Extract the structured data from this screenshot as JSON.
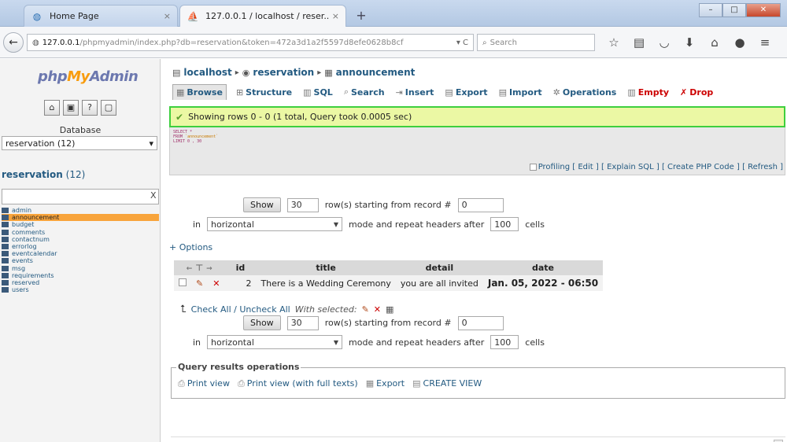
{
  "browser": {
    "tabs": [
      {
        "label": "Home Page",
        "active": false,
        "icon": "globe-icon"
      },
      {
        "label": "127.0.0.1 / localhost / reser...",
        "active": true,
        "icon": "pma-favicon"
      }
    ],
    "url_host": "127.0.0.1",
    "url_path": "/phpmyadmin/index.php?db=reservation&token=472a3d1a2f5597d8efe0628b8cf",
    "search_placeholder": "Search",
    "new_tab": "+"
  },
  "sidebar": {
    "logo": {
      "php": "php",
      "my": "My",
      "admin": "Admin"
    },
    "database_label": "Database",
    "database_selected": "reservation (12)",
    "db_name": "reservation",
    "db_count": "(12)",
    "filter_clear": "X",
    "tables": [
      {
        "label": "admin",
        "selected": false
      },
      {
        "label": "announcement",
        "selected": true
      },
      {
        "label": "budget",
        "selected": false
      },
      {
        "label": "comments",
        "selected": false
      },
      {
        "label": "contactnum",
        "selected": false
      },
      {
        "label": "errorlog",
        "selected": false
      },
      {
        "label": "eventcalendar",
        "selected": false
      },
      {
        "label": "events",
        "selected": false
      },
      {
        "label": "msg",
        "selected": false
      },
      {
        "label": "requirements",
        "selected": false
      },
      {
        "label": "reserved",
        "selected": false
      },
      {
        "label": "users",
        "selected": false
      }
    ]
  },
  "breadcrumb": {
    "server": "localhost",
    "database": "reservation",
    "table": "announcement"
  },
  "tabs": [
    {
      "label": "Browse",
      "icon": "browse-icon",
      "active": true
    },
    {
      "label": "Structure",
      "icon": "structure-icon"
    },
    {
      "label": "SQL",
      "icon": "sql-icon"
    },
    {
      "label": "Search",
      "icon": "search-icon"
    },
    {
      "label": "Insert",
      "icon": "insert-icon"
    },
    {
      "label": "Export",
      "icon": "export-icon"
    },
    {
      "label": "Import",
      "icon": "import-icon"
    },
    {
      "label": "Operations",
      "icon": "operations-icon"
    },
    {
      "label": "Empty",
      "icon": "empty-icon",
      "danger": true
    },
    {
      "label": "Drop",
      "icon": "drop-icon",
      "danger": true
    }
  ],
  "status": {
    "message": "Showing rows 0 - 0 (1 total, Query took 0.0005 sec)"
  },
  "sql": {
    "line1": "SELECT *",
    "line2_kw": "FROM",
    "line2_str": "`announcement`",
    "line3": "LIMIT 0 , 30"
  },
  "sql_links": {
    "profiling": "Profiling",
    "edit": "[ Edit ]",
    "explain": "[ Explain SQL ]",
    "create_php": "[ Create PHP Code ]",
    "refresh": "[ Refresh ]"
  },
  "nav": {
    "show": "Show",
    "rows": "30",
    "starting_text": "row(s) starting from record #",
    "record": "0",
    "in": "in",
    "mode": "horizontal",
    "mode_text": "mode and repeat headers after",
    "headers": "100",
    "cells": "cells"
  },
  "options_link": "+ Options",
  "table": {
    "columns": [
      "id",
      "title",
      "detail",
      "date"
    ],
    "rows": [
      {
        "id": "2",
        "title": "There is a Wedding Ceremony",
        "detail": "you are all invited",
        "date": "Jan. 05, 2022 - 06:50"
      }
    ]
  },
  "check_all": {
    "label": "Check All / Uncheck All",
    "with_selected": "With selected:"
  },
  "query_ops": {
    "legend": "Query results operations",
    "print_view": "Print view",
    "print_full": "Print view (with full texts)",
    "export": "Export",
    "create_view": "CREATE VIEW"
  }
}
